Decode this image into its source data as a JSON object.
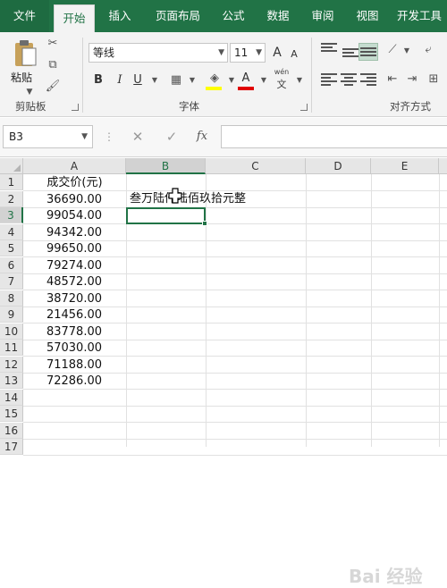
{
  "ribbon": {
    "tabs": [
      "文件",
      "开始",
      "插入",
      "页面布局",
      "公式",
      "数据",
      "审阅",
      "视图",
      "开发工具"
    ],
    "clipboard": {
      "paste_label": "粘贴",
      "group_label": "剪贴板"
    },
    "font": {
      "name": "等线",
      "size": "11",
      "group_label": "字体",
      "font_grow": "A",
      "font_shrink": "A",
      "bold": "B",
      "italic": "I",
      "underline": "U",
      "font_color_glyph": "A",
      "phonetic_top": "wén",
      "phonetic_bottom": "文"
    },
    "alignment": {
      "group_label": "对齐方式"
    }
  },
  "formula_bar": {
    "name_box": "B3",
    "cancel": "✕",
    "enter": "✓",
    "fx": "fx",
    "formula": ""
  },
  "sheet": {
    "columns": [
      "A",
      "B",
      "C",
      "D",
      "E"
    ],
    "rows": [
      "1",
      "2",
      "3",
      "4",
      "5",
      "6",
      "7",
      "8",
      "9",
      "10",
      "11",
      "12",
      "13",
      "14",
      "15",
      "16",
      "17"
    ],
    "header_a1": "成交价(元)",
    "values": [
      "36690.00",
      "99054.00",
      "94342.00",
      "99650.00",
      "79274.00",
      "48572.00",
      "38720.00",
      "21456.00",
      "83778.00",
      "57030.00",
      "71188.00",
      "72286.00"
    ],
    "b2_text": "叁万陆仟陆佰玖拾元整",
    "active_cell": "B3",
    "watermark": "Bai 经验"
  },
  "colors": {
    "accent": "#217346",
    "ribbon_bg": "#f3f3f3"
  }
}
